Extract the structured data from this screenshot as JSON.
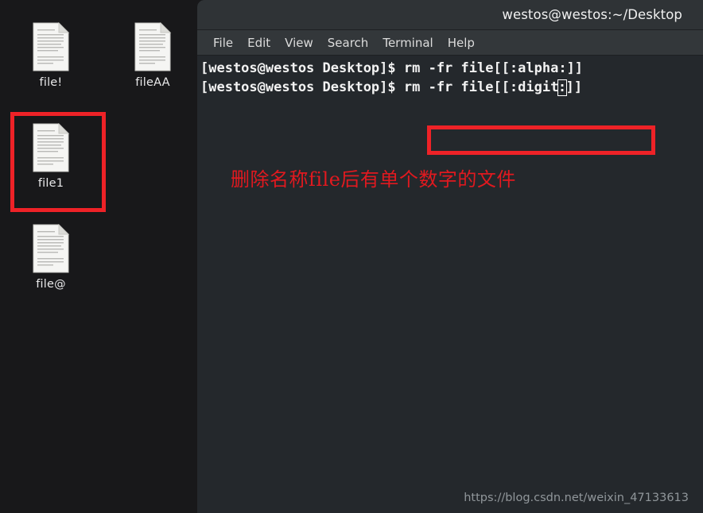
{
  "desktop": {
    "background_color": "#18181a",
    "icons": [
      {
        "name": "file-bang",
        "label": "file!",
        "icon": "document-icon",
        "selected": false
      },
      {
        "name": "fileaa",
        "label": "fileAA",
        "icon": "document-icon",
        "selected": false
      },
      {
        "name": "file1",
        "label": "file1",
        "icon": "document-icon",
        "selected": true
      },
      {
        "name": "fileat",
        "label": "file@",
        "icon": "document-icon",
        "selected": false
      }
    ]
  },
  "terminal": {
    "title": "westos@westos:~/Desktop",
    "menu": [
      {
        "label": "File"
      },
      {
        "label": "Edit"
      },
      {
        "label": "View"
      },
      {
        "label": "Search"
      },
      {
        "label": "Terminal"
      },
      {
        "label": "Help"
      }
    ],
    "background_color": "#24282c",
    "titlebar_color": "#2f3336",
    "menubar_color": "#33373a",
    "lines": [
      {
        "prompt": "[westos@westos Desktop]$ ",
        "command": "rm -fr file[[:alpha:]]",
        "highlighted": false
      },
      {
        "prompt": "[westos@westos Desktop]$ ",
        "command_before_cursor": "rm -fr file[[:digit",
        "cursor_char": ":",
        "command_after_cursor": "]]",
        "highlighted": true
      }
    ]
  },
  "annotations": {
    "chinese_note": "删除名称file后有单个数字的文件",
    "highlight_color": "#ee2227",
    "note_color": "#e1191f"
  },
  "watermark": {
    "text": "https://blog.csdn.net/weixin_47133613"
  }
}
